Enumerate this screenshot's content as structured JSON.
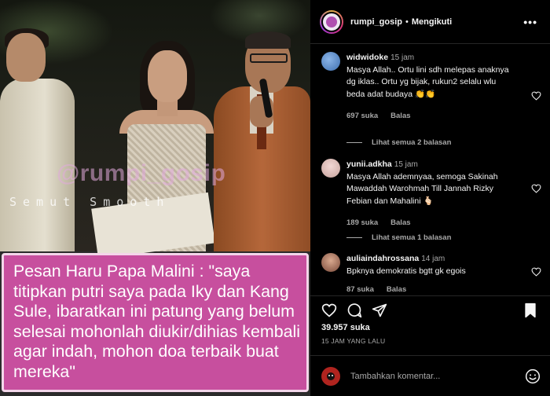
{
  "media": {
    "watermark_handle": "@rumpi_gosip",
    "watermark_sub": "Semut Smooth",
    "caption": "Pesan Haru Papa Malini : \"saya titipkan putri saya pada Iky dan Kang Sule, ibaratkan ini patung yang belum selesai mohonlah diukir/dihias kembali agar indah, mohon doa terbaik buat mereka\"",
    "caption_bg_color": "#c74f9e"
  },
  "header": {
    "username": "rumpi_gosip",
    "separator": "•",
    "follow_status": "Mengikuti",
    "more_icon": "more-horizontal-icon"
  },
  "comments": [
    {
      "username": "widwidoke",
      "time": "15 jam",
      "text": "Masya Allah.. Ortu lini sdh melepas anaknya dg iklas.. Ortu yg bijak, rukun2 selalu wlu beda adat budaya 👏👏",
      "likes": "697 suka",
      "reply": "Balas",
      "view_replies": "Lihat semua 2 balasan"
    },
    {
      "username": "yunii.adkha",
      "time": "15 jam",
      "text": "Masya Allah ademnyaa, semoga Sakinah Mawaddah Warohmah Till Jannah Rizky Febian dan Mahalini 🫰🏻",
      "likes": "189 suka",
      "reply": "Balas",
      "view_replies": "Lihat semua 1 balasan"
    },
    {
      "username": "auliaindahrossana",
      "time": "14 jam",
      "text": "Bpknya demokratis bgtt gk egois",
      "likes": "87 suka",
      "reply": "Balas"
    }
  ],
  "actions": {
    "like_icon": "heart-icon",
    "comment_icon": "comment-icon",
    "share_icon": "send-icon",
    "save_icon": "bookmark-icon",
    "likes_count": "39.957 suka",
    "posted_time": "15 JAM YANG LALU"
  },
  "add_comment": {
    "placeholder": "Tambahkan komentar...",
    "emoji_icon": "smiley-icon"
  }
}
